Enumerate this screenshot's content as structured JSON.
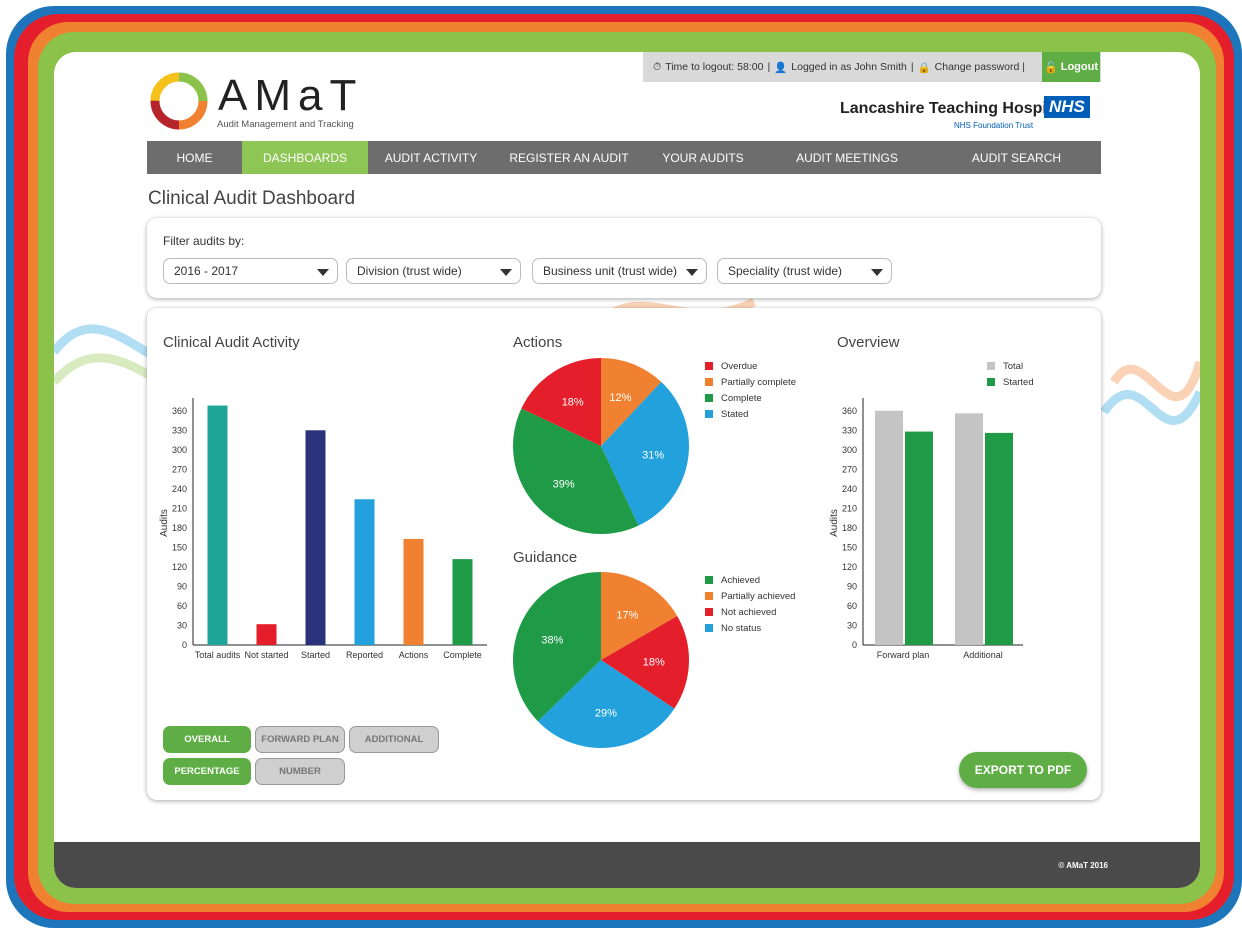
{
  "topbar": {
    "timer_icon": "stopwatch-icon",
    "logout_time": "Time to logout: 58:00",
    "sep1": "|",
    "user_icon": "user-icon",
    "logged_in": "Logged in as John Smith",
    "sep2": "|",
    "lock_icon": "lock-icon",
    "change_password": "Change password |",
    "logout_label": "Logout"
  },
  "logo": {
    "name": "AMaT",
    "subtitle": "Audit Management and Tracking"
  },
  "trust": {
    "name": "Lancashire Teaching Hospitals",
    "badge": "NHS",
    "foundation": "NHS Foundation Trust"
  },
  "nav": {
    "items": [
      "HOME",
      "DASHBOARDS",
      "AUDIT ACTIVITY",
      "REGISTER AN AUDIT",
      "YOUR AUDITS",
      "AUDIT MEETINGS",
      "AUDIT SEARCH"
    ],
    "active": "DASHBOARDS"
  },
  "page": {
    "title": "Clinical Audit Dashboard"
  },
  "filters": {
    "label": "Filter audits by:",
    "year": "2016 - 2017",
    "division": "Division (trust wide)",
    "business_unit": "Business unit (trust wide)",
    "speciality": "Speciality (trust wide)"
  },
  "colors": {
    "green": "#5fad45",
    "nav_active": "#8ec655",
    "red": "#e41f2b",
    "orange": "#f08130",
    "blue": "#22a1dc",
    "dark_green": "#1f9b48",
    "teal": "#1fa597",
    "navy": "#29327a",
    "grey": "#c4c4c4"
  },
  "chart_data": [
    {
      "type": "bar",
      "title": "Clinical Audit Activity",
      "ylabel": "Audits",
      "ylim": [
        0,
        375
      ],
      "yticks": [
        0,
        30,
        60,
        90,
        120,
        150,
        180,
        210,
        240,
        270,
        300,
        330,
        360
      ],
      "categories": [
        "Total audits",
        "Not started",
        "Started",
        "Reported",
        "Actions",
        "Complete"
      ],
      "values": [
        368,
        32,
        330,
        224,
        163,
        132
      ],
      "bar_colors": [
        "#1fa597",
        "#e41f2b",
        "#29327a",
        "#22a1dc",
        "#f08130",
        "#1f9b48"
      ]
    },
    {
      "type": "pie",
      "title": "Actions",
      "labels": [
        "Overdue",
        "Partially complete",
        "Complete",
        "Stated"
      ],
      "values": [
        18,
        12,
        39,
        31
      ],
      "value_labels": [
        "18%",
        "12%",
        "39%",
        "31%"
      ],
      "colors": [
        "#e41f2b",
        "#f08130",
        "#1f9b48",
        "#22a1dc"
      ]
    },
    {
      "type": "pie",
      "title": "Guidance",
      "labels": [
        "Achieved",
        "Partially achieved",
        "Not achieved",
        "No status"
      ],
      "values": [
        38,
        17,
        18,
        29
      ],
      "value_labels": [
        "38%",
        "17%",
        "18%",
        "29%"
      ],
      "colors": [
        "#1f9b48",
        "#f08130",
        "#e41f2b",
        "#22a1dc"
      ]
    },
    {
      "type": "bar",
      "title": "Overview",
      "ylabel": "Audits",
      "ylim": [
        0,
        375
      ],
      "yticks": [
        0,
        30,
        60,
        90,
        120,
        150,
        180,
        210,
        240,
        270,
        300,
        330,
        360
      ],
      "categories": [
        "Forward plan",
        "Additional"
      ],
      "series": [
        {
          "name": "Total",
          "values": [
            360,
            356
          ],
          "color": "#c4c4c4"
        },
        {
          "name": "Started",
          "values": [
            328,
            326
          ],
          "color": "#1f9b48"
        }
      ]
    }
  ],
  "buttons": {
    "overall": "OVERALL",
    "forward_plan": "FORWARD PLAN",
    "additional": "ADDITIONAL",
    "percentage": "PERCENTAGE",
    "number": "NUMBER",
    "export": "EXPORT TO PDF"
  },
  "footer": {
    "copyright": "© AMaT 2016"
  }
}
